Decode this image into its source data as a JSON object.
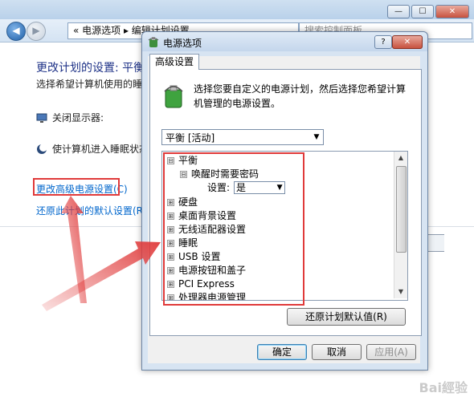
{
  "background_window": {
    "address_path": "« 电源选项 ▸ 编辑计划设置",
    "search_placeholder": "搜索控制面板",
    "heading": "更改计划的设置: 平衡",
    "description": "选择希望计算机使用的睡眠设",
    "turn_off_display_label": "关闭显示器:",
    "sleep_label": "使计算机进入睡眠状态:",
    "change_advanced_link": "更改高级电源设置(C)",
    "restore_defaults_link": "还原此计划的默认设置(R)",
    "window_buttons": {
      "minimize": "—",
      "maximize": "☐",
      "close": "✕"
    },
    "nav": {
      "back": "◀",
      "forward": "▶"
    }
  },
  "dialog": {
    "title": "电源选项",
    "help_button": "?",
    "close_button": "✕",
    "tab_label": "高级设置",
    "intro_text": "选择您要自定义的电源计划，然后选择您希望计算机管理的电源设置。",
    "plan_selected": "平衡 [活动]",
    "tree_items": [
      {
        "label": "平衡",
        "toggle": "⊟"
      },
      {
        "label": "唤醒时需要密码",
        "toggle": "⊟"
      },
      {
        "label": "设置:",
        "value": "是"
      },
      {
        "label": "硬盘",
        "toggle": "⊞"
      },
      {
        "label": "桌面背景设置",
        "toggle": "⊞"
      },
      {
        "label": "无线适配器设置",
        "toggle": "⊞"
      },
      {
        "label": "睡眠",
        "toggle": "⊞"
      },
      {
        "label": "USB 设置",
        "toggle": "⊞"
      },
      {
        "label": "电源按钮和盖子",
        "toggle": "⊞"
      },
      {
        "label": "PCI Express",
        "toggle": "⊞"
      },
      {
        "label": "处理器电源管理",
        "toggle": "⊞"
      }
    ],
    "restore_button": "还原计划默认值(R)",
    "ok_button": "确定",
    "cancel_button": "取消",
    "apply_button": "应用(A)"
  },
  "annotation_colors": {
    "highlight": "#e03a3a"
  },
  "watermark": "Bai經验"
}
